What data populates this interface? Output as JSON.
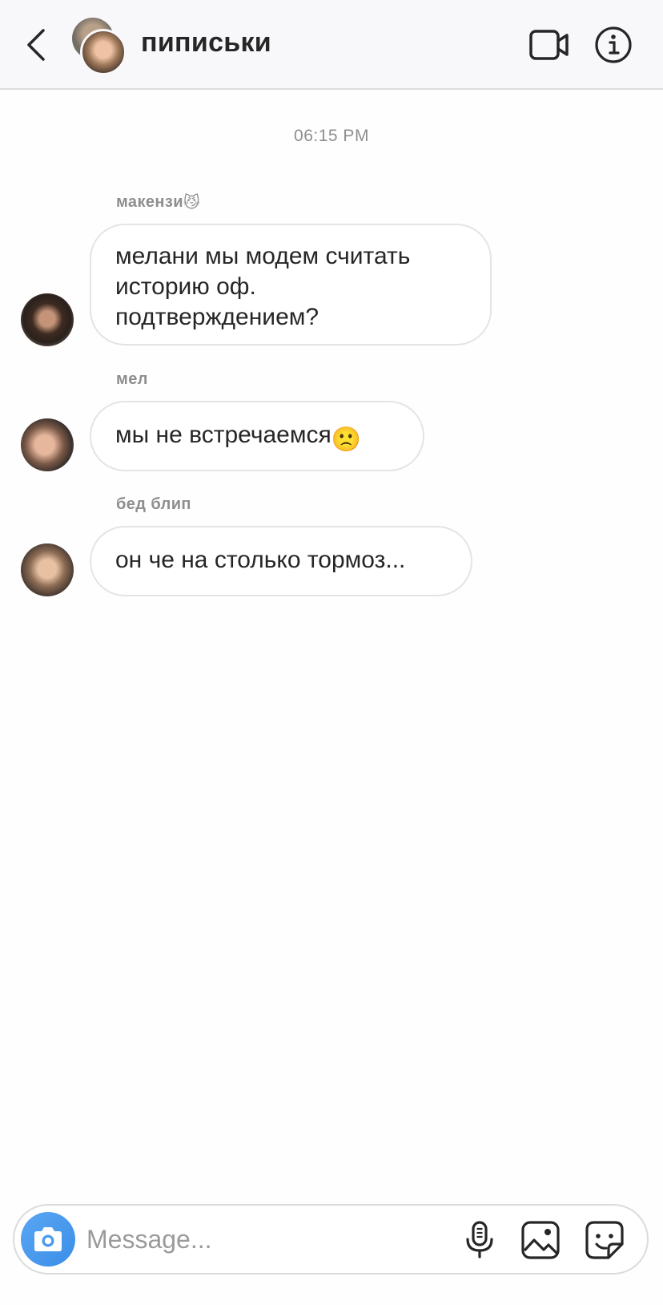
{
  "header": {
    "title": "пиписьки",
    "back_icon": "chevron-left-icon",
    "video_icon": "video-call-icon",
    "info_icon": "info-icon"
  },
  "timestamp": "06:15 PM",
  "messages": [
    {
      "sender": "макензи",
      "sender_emoji": "😼",
      "text": "мелани мы модем считать историю оф. подтверждением?",
      "text_emoji": ""
    },
    {
      "sender": "мел",
      "sender_emoji": "",
      "text": "мы не встречаемся",
      "text_emoji": "🙁"
    },
    {
      "sender": "бед блип",
      "sender_emoji": "",
      "text": "он че на столько тормоз...",
      "text_emoji": ""
    }
  ],
  "composer": {
    "placeholder": "Message...",
    "camera_icon": "camera-icon",
    "mic_icon": "microphone-icon",
    "gallery_icon": "gallery-icon",
    "sticker_icon": "sticker-icon"
  },
  "colors": {
    "header_bg": "#f8f8fa",
    "text_primary": "#262626",
    "text_secondary": "#8e8e8e",
    "bubble_border": "#e4e4e4",
    "camera_blue": "#3a8ee8"
  }
}
